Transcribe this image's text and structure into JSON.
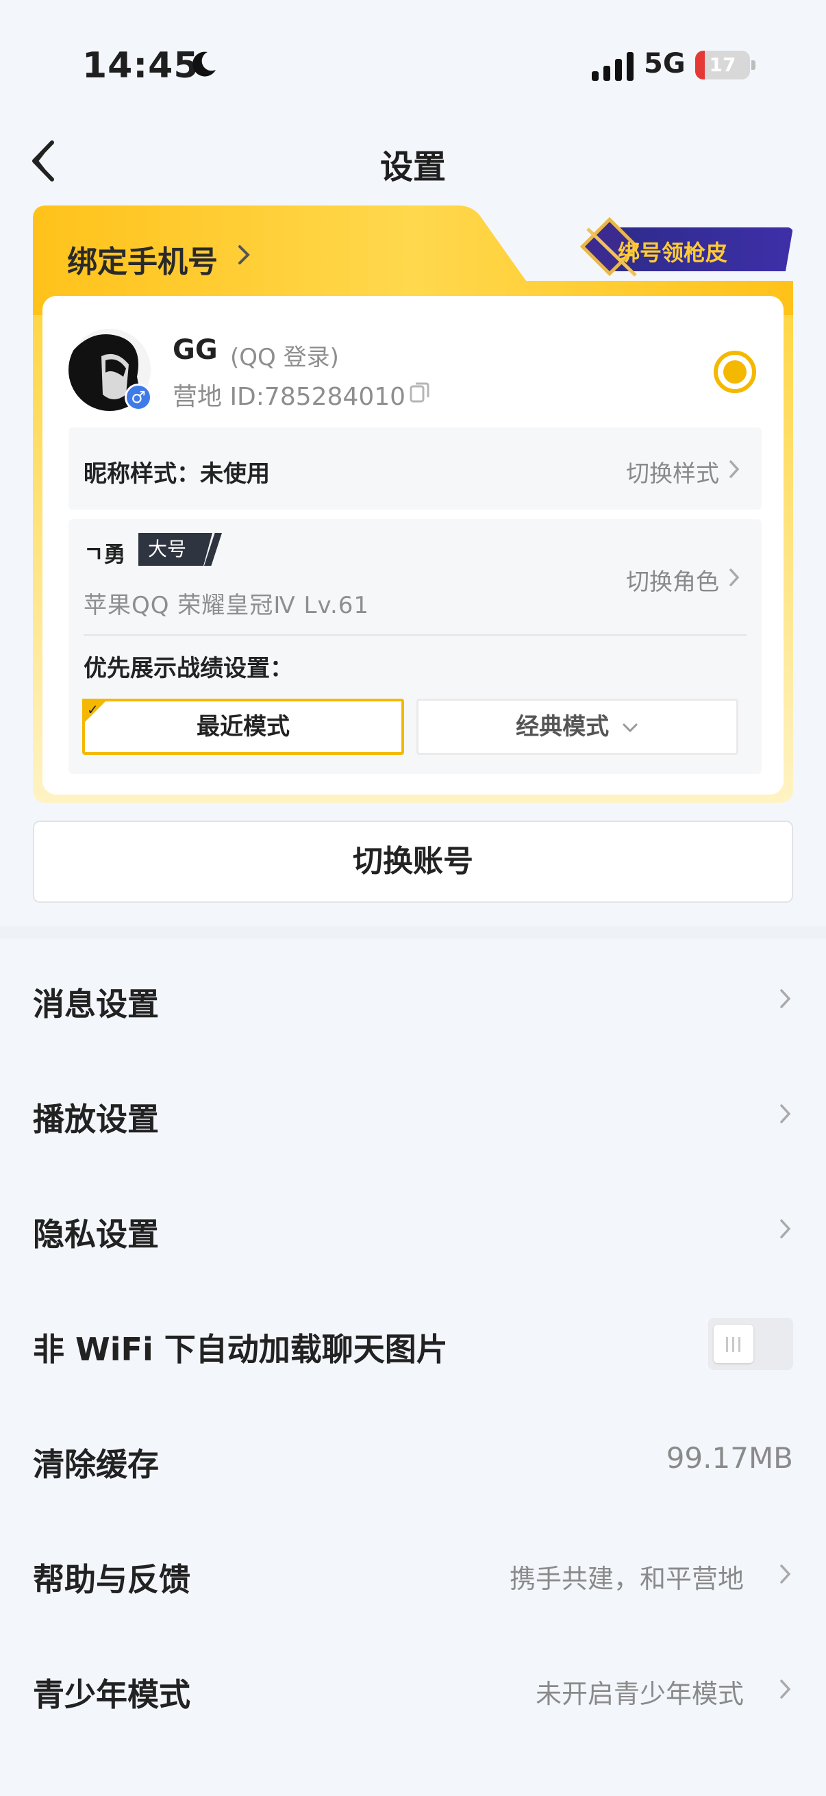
{
  "status_bar": {
    "time": "14:45",
    "network": "5G",
    "battery": "17",
    "battery_level": 0.17
  },
  "nav": {
    "title": "设置"
  },
  "bind_card": {
    "title": "绑定手机号",
    "promo": "绑号领枪皮",
    "user": {
      "name": "GG",
      "login_type": "(QQ 登录)",
      "camp_id": "营地 ID:785284010",
      "gender": "♂"
    },
    "nickname_style": {
      "label": "昵称样式：未使用",
      "action": "切换样式"
    },
    "role": {
      "name": "ㄱ勇",
      "tag": "大号",
      "info": "苹果QQ  荣耀皇冠Ⅳ  Lv.61",
      "action": "切换角色"
    },
    "priority_label": "优先展示战绩设置：",
    "modes": {
      "recent": "最近模式",
      "classic": "经典模式"
    }
  },
  "switch_account": "切换账号",
  "settings": [
    {
      "label": "消息设置"
    },
    {
      "label": "播放设置"
    },
    {
      "label": "隐私设置"
    },
    {
      "label": "非 WiFi 下自动加载聊天图片",
      "toggle": false
    },
    {
      "label": "清除缓存",
      "value": "99.17MB"
    },
    {
      "label": "帮助与反馈",
      "value": "携手共建，和平营地"
    },
    {
      "label": "青少年模式",
      "value": "未开启青少年模式"
    }
  ],
  "colors": {
    "accent": "#f5b800",
    "promo_bg": "#2d2b8a",
    "gender_badge": "#3f7be8"
  }
}
